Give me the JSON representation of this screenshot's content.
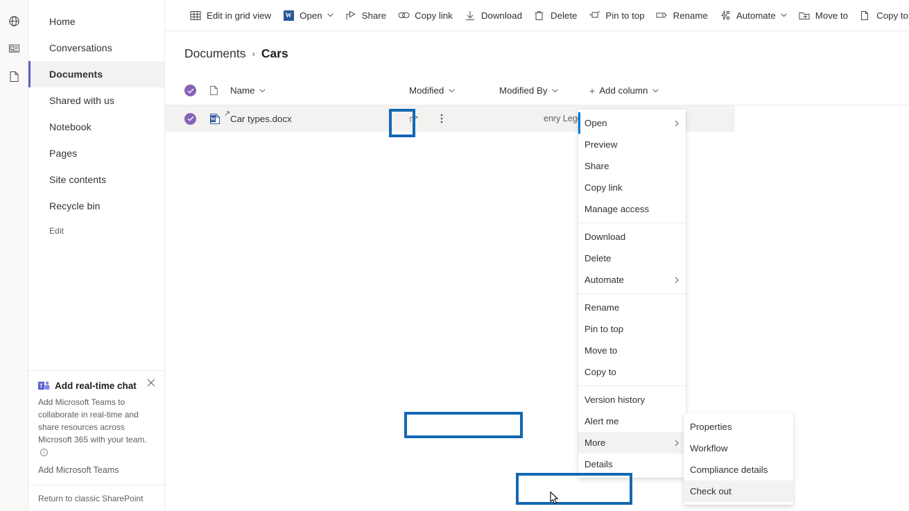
{
  "rail": {
    "items": [
      {
        "name": "globe-icon",
        "label": "Sites"
      },
      {
        "name": "news-icon",
        "label": "News"
      },
      {
        "name": "page-icon",
        "label": "Page"
      }
    ]
  },
  "sidebar": {
    "items": [
      {
        "label": "Home",
        "selected": false
      },
      {
        "label": "Conversations",
        "selected": false
      },
      {
        "label": "Documents",
        "selected": true
      },
      {
        "label": "Shared with us",
        "selected": false
      },
      {
        "label": "Notebook",
        "selected": false
      },
      {
        "label": "Pages",
        "selected": false
      },
      {
        "label": "Site contents",
        "selected": false
      },
      {
        "label": "Recycle bin",
        "selected": false
      }
    ],
    "edit_label": "Edit",
    "promo": {
      "title": "Add real-time chat",
      "description": "Add Microsoft Teams to collaborate in real-time and share resources across Microsoft 365 with your team.",
      "info_glyph": "i",
      "link_label": "Add Microsoft Teams",
      "close_icon": "close-icon"
    },
    "classic_link": "Return to classic SharePoint"
  },
  "toolbar": {
    "items": [
      {
        "label": "Edit in grid view",
        "icon": "grid-icon",
        "chevron": false
      },
      {
        "label": "Open",
        "icon": "word-icon",
        "chevron": true
      },
      {
        "label": "Share",
        "icon": "share-icon",
        "chevron": false
      },
      {
        "label": "Copy link",
        "icon": "link-icon",
        "chevron": false
      },
      {
        "label": "Download",
        "icon": "download-icon",
        "chevron": false
      },
      {
        "label": "Delete",
        "icon": "trash-icon",
        "chevron": false
      },
      {
        "label": "Pin to top",
        "icon": "pin-icon",
        "chevron": false
      },
      {
        "label": "Rename",
        "icon": "rename-icon",
        "chevron": false
      },
      {
        "label": "Automate",
        "icon": "automate-icon",
        "chevron": true
      },
      {
        "label": "Move to",
        "icon": "move-icon",
        "chevron": false
      },
      {
        "label": "Copy to",
        "icon": "copy-icon",
        "chevron": false
      }
    ],
    "overflow_label": "···"
  },
  "breadcrumb": {
    "root": "Documents",
    "separator": "›",
    "leaf": "Cars"
  },
  "list": {
    "columns": [
      {
        "label": "Name",
        "chevron": true
      },
      {
        "label": "Modified",
        "chevron": true
      },
      {
        "label": "Modified By",
        "chevron": true
      }
    ],
    "add_column_label": "Add column",
    "add_column_plus": "+",
    "rows": [
      {
        "name": "Car types.docx",
        "file_type": "word",
        "selected": true,
        "modified": "",
        "modified_by": "enry Legge"
      }
    ]
  },
  "context_menu": {
    "items": [
      {
        "label": "Open",
        "submenu": true,
        "focused": true
      },
      {
        "label": "Preview",
        "submenu": false
      },
      {
        "label": "Share",
        "submenu": false
      },
      {
        "label": "Copy link",
        "submenu": false
      },
      {
        "label": "Manage access",
        "submenu": false
      },
      {
        "separator": true
      },
      {
        "label": "Download",
        "submenu": false
      },
      {
        "label": "Delete",
        "submenu": false
      },
      {
        "label": "Automate",
        "submenu": true
      },
      {
        "separator": true
      },
      {
        "label": "Rename",
        "submenu": false
      },
      {
        "label": "Pin to top",
        "submenu": false
      },
      {
        "label": "Move to",
        "submenu": false
      },
      {
        "label": "Copy to",
        "submenu": false
      },
      {
        "separator": true
      },
      {
        "label": "Version history",
        "submenu": false
      },
      {
        "label": "Alert me",
        "submenu": false
      },
      {
        "label": "More",
        "submenu": true,
        "highlight": true
      },
      {
        "label": "Details",
        "submenu": false
      }
    ]
  },
  "submenu": {
    "items": [
      {
        "label": "Properties"
      },
      {
        "label": "Workflow"
      },
      {
        "label": "Compliance details"
      },
      {
        "label": "Check out",
        "highlight": true
      }
    ]
  },
  "annotations": {
    "color": "#1268b3",
    "targets": [
      "more-actions-kebab",
      "more-menu-item",
      "check-out-menu-item"
    ]
  },
  "colors": {
    "accent_blue": "#0078d4",
    "annotation_blue": "#1268b3",
    "selection_purple": "#8764b8",
    "nav_indicator": "#5b5fc7",
    "word_blue": "#2b579a",
    "row_hover": "#f3f2f1"
  }
}
